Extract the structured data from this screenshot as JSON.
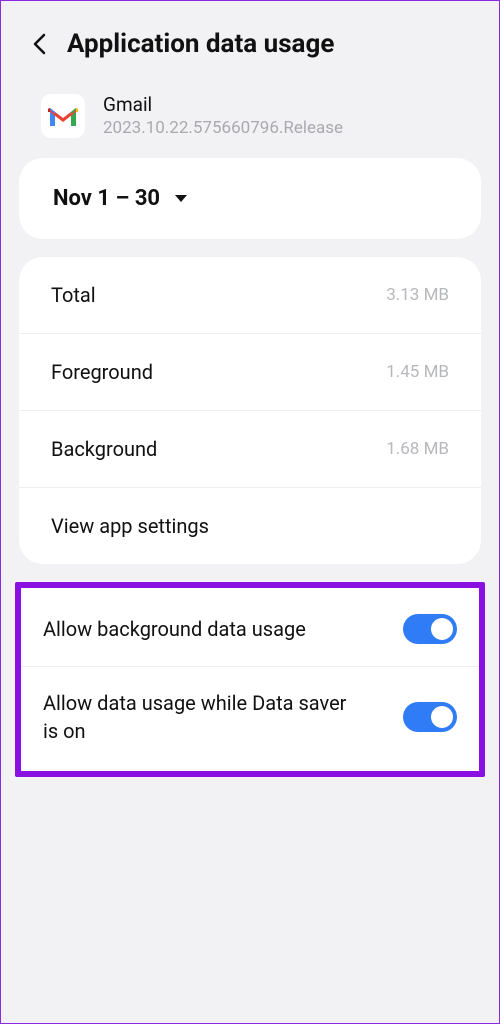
{
  "header": {
    "title": "Application data usage"
  },
  "app": {
    "name": "Gmail",
    "version": "2023.10.22.575660796.Release"
  },
  "datePicker": {
    "range": "Nov 1 – 30"
  },
  "usage": {
    "total_label": "Total",
    "total_value": "3.13 MB",
    "foreground_label": "Foreground",
    "foreground_value": "1.45 MB",
    "background_label": "Background",
    "background_value": "1.68 MB",
    "view_settings": "View app settings"
  },
  "toggles": {
    "bg_data_label": "Allow background data usage",
    "data_saver_label": "Allow data usage while Data saver is on"
  }
}
